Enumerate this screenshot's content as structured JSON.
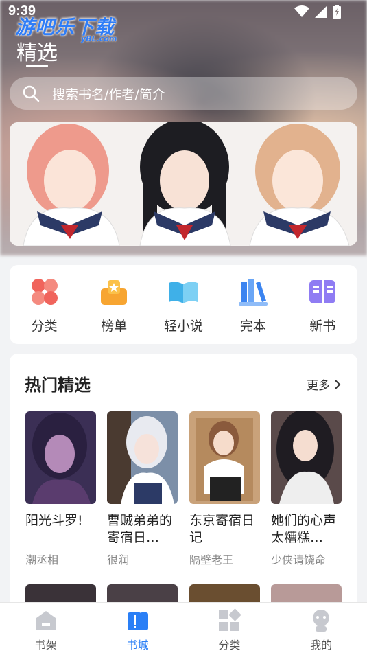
{
  "status": {
    "time": "9:39"
  },
  "watermark": {
    "text": "游吧乐下载",
    "sub": "yBL.com"
  },
  "header": {
    "title": "精选"
  },
  "search": {
    "placeholder": "搜索书名/作者/简介"
  },
  "quick_nav": [
    {
      "label": "分类",
      "icon": "grid-flower-icon",
      "color": "#f0645c"
    },
    {
      "label": "榜单",
      "icon": "ranking-icon",
      "color": "#f7a531"
    },
    {
      "label": "轻小说",
      "icon": "open-book-icon",
      "color": "#3fb0e8"
    },
    {
      "label": "完本",
      "icon": "books-icon",
      "color": "#3b84f0"
    },
    {
      "label": "新书",
      "icon": "new-book-icon",
      "color": "#8f7cf3"
    }
  ],
  "hot": {
    "title": "热门精选",
    "more": "更多",
    "books": [
      {
        "title": "阳光斗罗!",
        "author": "潮丞相"
      },
      {
        "title": "曹贼弟弟的寄宿日…",
        "author": "很润"
      },
      {
        "title": "东京寄宿日记",
        "author": "隔壁老王"
      },
      {
        "title": "她们的心声太糟糕…",
        "author": "少侠请饶命"
      }
    ]
  },
  "tabs": [
    {
      "label": "书架",
      "icon": "bookshelf-icon",
      "active": false
    },
    {
      "label": "书城",
      "icon": "bookstore-icon",
      "active": true
    },
    {
      "label": "分类",
      "icon": "category-icon",
      "active": false
    },
    {
      "label": "我的",
      "icon": "profile-icon",
      "active": false
    }
  ],
  "colors": {
    "accent": "#2a7ff6"
  }
}
